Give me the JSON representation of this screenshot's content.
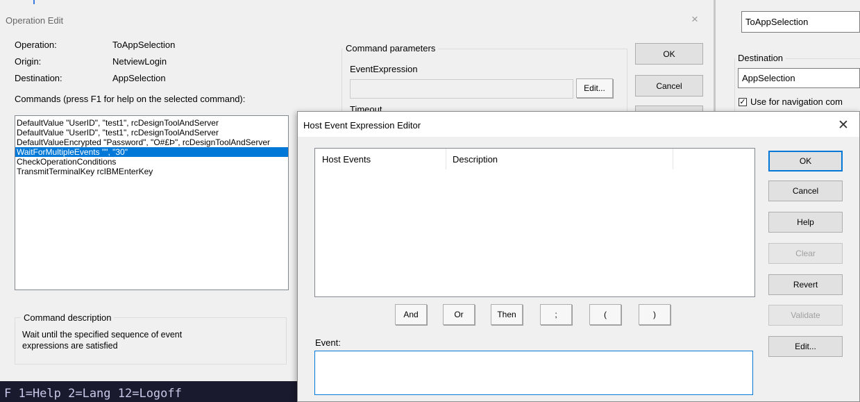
{
  "terminal": {
    "text": "F 1=Help 2=Lang 12=Logoff"
  },
  "operation_edit": {
    "title": "Operation Edit",
    "close_glyph": "×",
    "fields": [
      {
        "label": "Operation:",
        "value": "ToAppSelection"
      },
      {
        "label": "Origin:",
        "value": "NetviewLogin"
      },
      {
        "label": "Destination:",
        "value": "AppSelection"
      }
    ],
    "commands_label": "Commands (press F1 for help on the selected command):",
    "commands": [
      "DefaultValue \"UserID\", \"test1\", rcDesignToolAndServer",
      "DefaultValue \"UserID\", \"test1\", rcDesignToolAndServer",
      "DefaultValueEncrypted \"Password\", \"O#£Þ\", rcDesignToolAndServer",
      "WaitForMultipleEvents \"\", \"30\"",
      "CheckOperationConditions",
      "TransmitTerminalKey rcIBMEnterKey"
    ],
    "selected_command_index": 3,
    "command_parameters": {
      "group_label": "Command parameters",
      "event_expression_label": "EventExpression",
      "event_expression_value": "",
      "edit_button": "Edit...",
      "timeout_label": "Timeout"
    },
    "command_description": {
      "group_label": "Command description",
      "text": "Wait until the specified sequence of event expressions are satisfied"
    },
    "buttons": {
      "ok": "OK",
      "cancel": "Cancel"
    }
  },
  "right_panel": {
    "top_value": "ToAppSelection",
    "destination_label": "Destination",
    "destination_value": "AppSelection",
    "navigation_checkbox_label": "Use for navigation com",
    "navigation_checked": true
  },
  "host_event_editor": {
    "title": "Host Event Expression Editor",
    "close_glyph": "✕",
    "columns": [
      "Host Events",
      "Description"
    ],
    "rows": [],
    "operator_buttons": [
      "And",
      "Or",
      "Then",
      ";",
      "(",
      ")"
    ],
    "event_label": "Event:",
    "event_value": "",
    "side_buttons": [
      {
        "label": "OK",
        "state": "default"
      },
      {
        "label": "Cancel",
        "state": "enabled"
      },
      {
        "label": "Help",
        "state": "enabled"
      },
      {
        "label": "Clear",
        "state": "disabled"
      },
      {
        "label": "Revert",
        "state": "enabled"
      },
      {
        "label": "Validate",
        "state": "disabled"
      },
      {
        "label": "Edit...",
        "state": "enabled"
      }
    ]
  }
}
